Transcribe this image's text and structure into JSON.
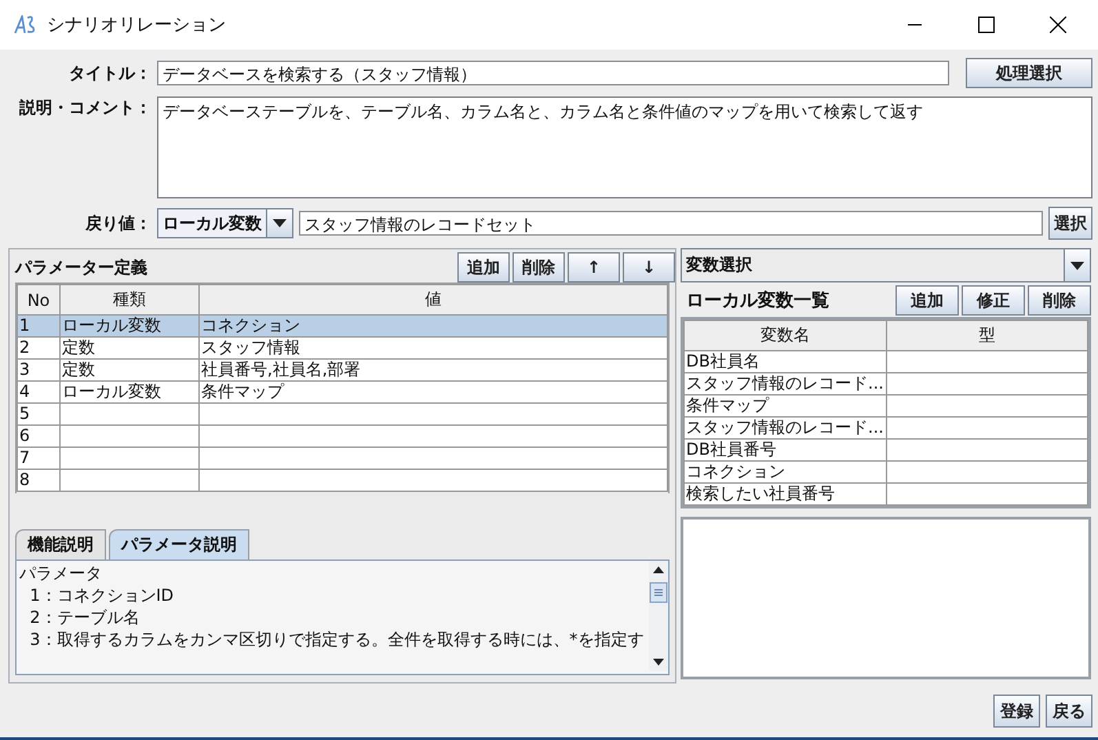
{
  "window": {
    "title": "シナリオリレーション"
  },
  "form": {
    "title_label": "タイトル：",
    "title_value": "データベースを検索する（スタッフ情報）",
    "process_button": "処理選択",
    "comment_label": "説明・コメント：",
    "comment_value": "データベーステーブルを、テーブル名、カラム名と、カラム名と条件値のマップを用いて検索して返す",
    "return_label": "戻り値：",
    "return_kind": "ローカル変数",
    "return_value": "スタッフ情報のレコードセット",
    "select_button": "選択"
  },
  "parameters": {
    "heading": "パラメーター定義",
    "buttons": [
      "追加",
      "削除",
      "↑",
      "↓"
    ],
    "columns": [
      "No",
      "種類",
      "値"
    ],
    "rows": [
      {
        "no": "1",
        "kind": "ローカル変数",
        "value": "コネクション",
        "selected": true
      },
      {
        "no": "2",
        "kind": "定数",
        "value": "スタッフ情報",
        "selected": false
      },
      {
        "no": "3",
        "kind": "定数",
        "value": "社員番号,社員名,部署",
        "selected": false
      },
      {
        "no": "4",
        "kind": "ローカル変数",
        "value": "条件マップ",
        "selected": false
      },
      {
        "no": "5",
        "selected": false
      },
      {
        "no": "6",
        "selected": false
      },
      {
        "no": "7",
        "selected": false
      },
      {
        "no": "8",
        "selected": false
      }
    ]
  },
  "help_tabs": [
    {
      "label": "機能説明",
      "selected": false
    },
    {
      "label": "パラメータ説明",
      "selected": true
    }
  ],
  "help_lines": [
    "パラメータ",
    "  1：コネクションID",
    "  2：テーブル名",
    "  3：取得するカラムをカンマ区切りで指定する。全件を取得する時には、*を指定す"
  ],
  "variables": {
    "combo": "変数選択",
    "heading": "ローカル変数一覧",
    "buttons": [
      "追加",
      "修正",
      "削除"
    ],
    "columns": [
      "変数名",
      "型"
    ],
    "rows": [
      {
        "name": "DB社員名"
      },
      {
        "name": "スタッフ情報のレコード..."
      },
      {
        "name": "条件マップ"
      },
      {
        "name": "スタッフ情報のレコード..."
      },
      {
        "name": "DB社員番号"
      },
      {
        "name": "コネクション"
      },
      {
        "name": "検索したい社員番号"
      }
    ]
  },
  "footer_buttons": [
    "登録",
    "戻る"
  ]
}
